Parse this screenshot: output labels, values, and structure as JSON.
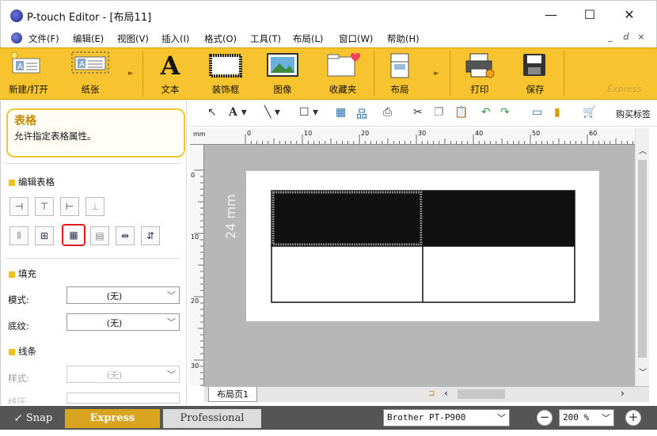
{
  "window": {
    "title": "P-touch Editor - [布局11]",
    "minimize": "—",
    "maximize": "☐",
    "close": "✕"
  },
  "menu": {
    "items": [
      "文件(F)",
      "编辑(E)",
      "视图(V)",
      "插入(I)",
      "格式(O)",
      "工具(T)",
      "布局(L)",
      "窗口(W)",
      "帮助(H)"
    ],
    "mdi": [
      "_",
      "ⅆ",
      "×"
    ]
  },
  "ribbon": {
    "new_open": "新建/打开",
    "paper": "纸张",
    "text": "文本",
    "frame": "装饰框",
    "image": "图像",
    "favorites": "收藏夹",
    "layout": "布局",
    "print": "打印",
    "save": "保存",
    "express": "Express"
  },
  "tip": {
    "title": "表格",
    "desc": "允许指定表格属性。"
  },
  "panel": {
    "edit_table": "编辑表格",
    "fill": "填充",
    "mode_label": "模式:",
    "mode_value": "(无)",
    "shading_label": "底纹:",
    "shading_value": "(无)",
    "lines": "线条",
    "style_label": "样式:",
    "style_value": "(无)",
    "line_label": "线压"
  },
  "toolbar": {
    "buy": "购买标签"
  },
  "ruler": {
    "unit": "mm",
    "top_ticks": [
      "0",
      "10",
      "20",
      "30",
      "40",
      "50",
      "60"
    ],
    "left_ticks": [
      "0",
      "10",
      "20",
      "30"
    ]
  },
  "canvas": {
    "size_text": "24 mm",
    "page_tab": "布局页1"
  },
  "status": {
    "snap": "Snap",
    "express": "Express",
    "professional": "Professional",
    "printer": "Brother PT-P900",
    "zoom": "200 %"
  },
  "colors": {
    "ribbon": "#f7c32e",
    "highlight": "#e01b1b",
    "canvas": "#b7b7b7",
    "status": "#555555"
  }
}
